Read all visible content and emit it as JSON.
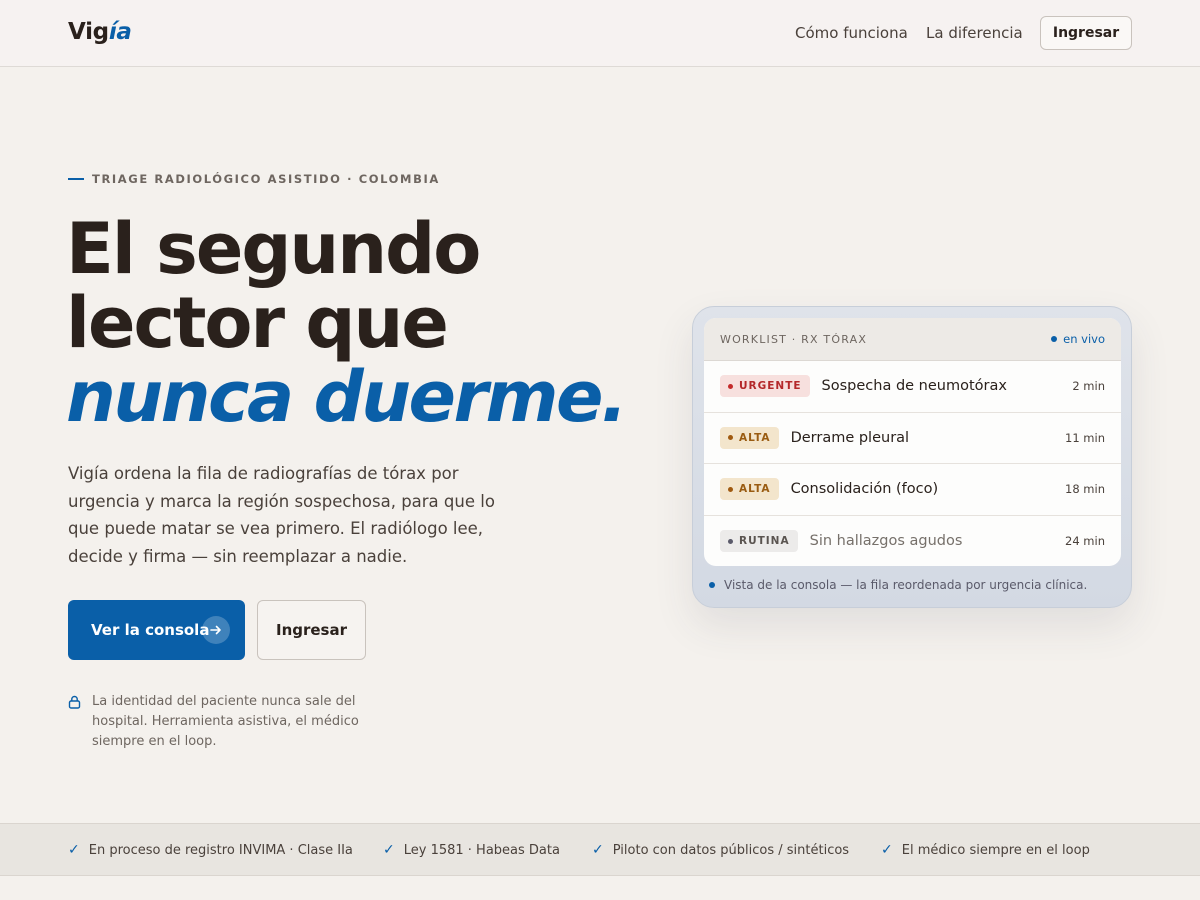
{
  "header": {
    "logo_main": "Vig",
    "logo_accent": "ía",
    "nav": [
      "Cómo funciona",
      "La diferencia"
    ],
    "login_label": "Ingresar"
  },
  "hero": {
    "eyebrow": "TRIAGE RADIOLÓGICO ASISTIDO · COLOMBIA",
    "headline_line1": "El segundo",
    "headline_line2": "lector que",
    "headline_em": "nunca duerme.",
    "lede": "Vigía ordena la fila de radiografías de tórax por urgencia y marca la región sospechosa, para que lo que puede matar se vea primero. El radiólogo lee, decide y firma — sin reemplazar a nadie.",
    "cta_primary": "Ver la consola",
    "cta_secondary": "Ingresar",
    "privacy_note": "La identidad del paciente nunca sale del hospital. Herramienta asistiva, el médico siempre en el loop."
  },
  "console": {
    "title": "WORKLIST · RX TÓRAX",
    "live_label": "en vivo",
    "rows": [
      {
        "badge": "URGENTE",
        "finding": "Sospecha de neumotórax",
        "time": "2 min"
      },
      {
        "badge": "ALTA",
        "finding": "Derrame pleural",
        "time": "11 min"
      },
      {
        "badge": "ALTA",
        "finding": "Consolidación (foco)",
        "time": "18 min"
      },
      {
        "badge": "RUTINA",
        "finding": "Sin hallazgos agudos",
        "time": "24 min"
      }
    ],
    "caption": "Vista de la consola — la fila reordenada por urgencia clínica."
  },
  "trust": [
    "En proceso de registro INVIMA · Clase IIa",
    "Ley 1581 · Habeas Data",
    "Piloto con datos públicos / sintéticos",
    "El médico siempre en el loop"
  ],
  "colors": {
    "accent": "#0a5fa8",
    "urgent": "#c42b2b",
    "high": "#a05a10",
    "routine": "#5a5a6a",
    "background": "#f4f1ed"
  },
  "icons": {
    "lock": "lock-icon",
    "arrow": "arrow-right-icon",
    "check": "check-icon"
  }
}
